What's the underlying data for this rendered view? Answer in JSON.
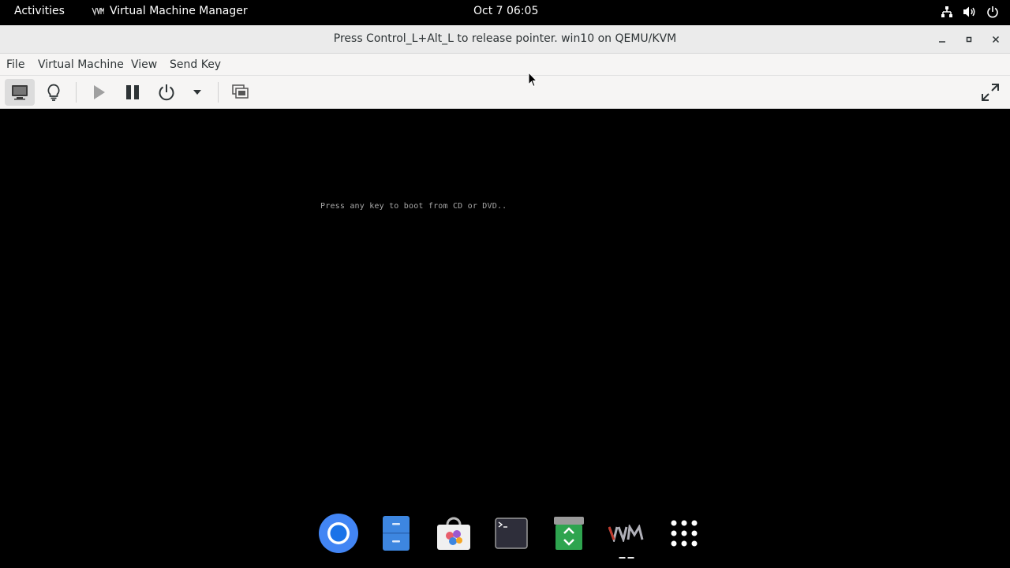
{
  "topbar": {
    "activities": "Activities",
    "app_name": "Virtual Machine Manager",
    "clock": "Oct 7  06:05",
    "tray_icons": [
      "network-icon",
      "volume-icon",
      "power-icon"
    ]
  },
  "window": {
    "title": "Press Control_L+Alt_L to release pointer. win10 on QEMU/KVM",
    "controls": [
      "minimize-icon",
      "maximize-icon",
      "close-icon"
    ]
  },
  "menubar": {
    "file": "File",
    "virtual_machine": "Virtual Machine",
    "view": "View",
    "send_key": "Send Key"
  },
  "toolbar": {
    "buttons": [
      "console-icon",
      "details-lightbulb-icon",
      "run-icon",
      "pause-icon",
      "shutdown-icon",
      "shutdown-menu-arrow-icon",
      "snapshots-icon",
      "fullscreen-icon"
    ]
  },
  "console": {
    "message": "Press any key to boot from CD or DVD.."
  },
  "dash": {
    "apps": [
      "chrome-icon",
      "files-icon",
      "software-icon",
      "terminal-icon",
      "trash-icon",
      "vmm-icon",
      "app-grid-icon"
    ]
  },
  "colors": {
    "topbar_bg": "#000000",
    "titlebar_bg": "#ebebeb",
    "menubar_bg": "#f6f5f4",
    "console_bg": "#000000",
    "boot_text": "#a8a8a8"
  }
}
